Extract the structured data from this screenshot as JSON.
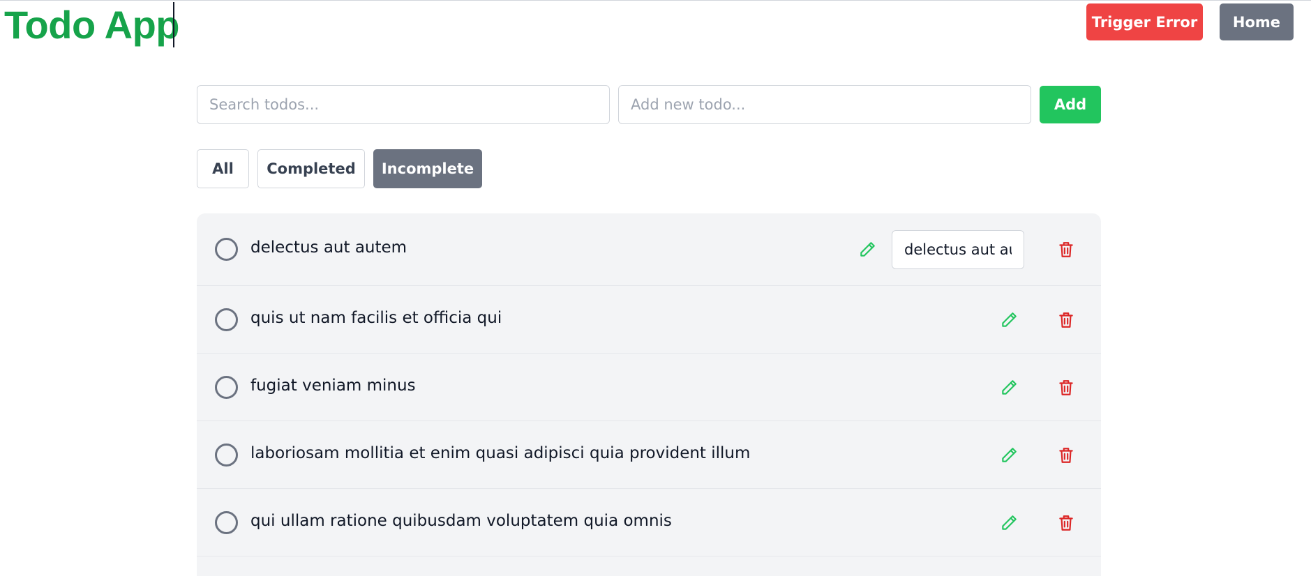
{
  "header": {
    "title": "Todo App",
    "trigger_error_label": "Trigger Error",
    "home_label": "Home"
  },
  "controls": {
    "search_placeholder": "Search todos...",
    "new_todo_placeholder": "Add new todo...",
    "add_label": "Add"
  },
  "filters": {
    "all": "All",
    "completed": "Completed",
    "incomplete": "Incomplete",
    "active": "incomplete"
  },
  "todos": [
    {
      "text": "delectus aut autem",
      "completed": false,
      "editing": true,
      "edit_value": "delectus aut autem"
    },
    {
      "text": "quis ut nam facilis et officia qui",
      "completed": false,
      "editing": false
    },
    {
      "text": "fugiat veniam minus",
      "completed": false,
      "editing": false
    },
    {
      "text": "laboriosam mollitia et enim quasi adipisci quia provident illum",
      "completed": false,
      "editing": false
    },
    {
      "text": "qui ullam ratione quibusdam voluptatem quia omnis",
      "completed": false,
      "editing": false
    }
  ],
  "colors": {
    "brand": "#16a34a",
    "error": "#ef4444",
    "neutral_button": "#6b7280",
    "add_button": "#22c55e",
    "edit_icon": "#22c55e",
    "delete_icon": "#dc2626",
    "list_background": "#f3f4f6"
  },
  "icons": {
    "edit": "pencil-icon",
    "delete": "trash-icon",
    "toggle": "circle-checkbox-icon"
  }
}
